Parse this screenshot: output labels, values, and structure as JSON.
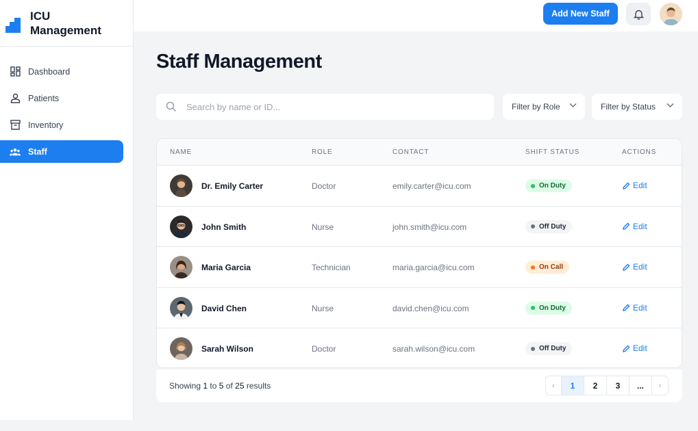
{
  "brand": {
    "line1": "ICU",
    "line2": "Management"
  },
  "sidebar": {
    "items": [
      {
        "label": "Dashboard",
        "icon": "dashboard-grid-icon",
        "active": false
      },
      {
        "label": "Patients",
        "icon": "person-icon",
        "active": false
      },
      {
        "label": "Inventory",
        "icon": "archive-box-icon",
        "active": false
      },
      {
        "label": "Staff",
        "icon": "group-icon",
        "active": true
      }
    ]
  },
  "topbar": {
    "add_label": "Add New Staff"
  },
  "page": {
    "title": "Staff Management"
  },
  "search": {
    "placeholder": "Search by name or ID..."
  },
  "filters": {
    "role": "Filter by Role",
    "status": "Filter by Status"
  },
  "table": {
    "headers": [
      "NAME",
      "ROLE",
      "CONTACT",
      "SHIFT STATUS",
      "ACTIONS"
    ],
    "rows": [
      {
        "name": "Dr. Emily Carter",
        "role": "Doctor",
        "contact": "emily.carter@icu.com",
        "status": "On Duty",
        "action": "Edit"
      },
      {
        "name": "John Smith",
        "role": "Nurse",
        "contact": "john.smith@icu.com",
        "status": "Off Duty",
        "action": "Edit"
      },
      {
        "name": "Maria Garcia",
        "role": "Technician",
        "contact": "maria.garcia@icu.com",
        "status": "On Call",
        "action": "Edit"
      },
      {
        "name": "David Chen",
        "role": "Nurse",
        "contact": "david.chen@icu.com",
        "status": "On Duty",
        "action": "Edit"
      },
      {
        "name": "Sarah Wilson",
        "role": "Doctor",
        "contact": "sarah.wilson@icu.com",
        "status": "Off Duty",
        "action": "Edit"
      }
    ]
  },
  "status_colors": {
    "On Duty": {
      "bg": "#dcfce7",
      "fg": "#166534",
      "dot": "#22c55e"
    },
    "Off Duty": {
      "bg": "#f3f4f6",
      "fg": "#1f2937",
      "dot": "#6b7280"
    },
    "On Call": {
      "bg": "#ffedd5",
      "fg": "#9a3412",
      "dot": "#f97316"
    }
  },
  "pagination": {
    "showing_prefix": "Showing",
    "from": "1",
    "to_word": "to",
    "to": "5",
    "of_word": "of",
    "total": "25",
    "suffix": "results",
    "prev": "‹",
    "pages": [
      "1",
      "2",
      "3",
      "..."
    ],
    "next": "›",
    "current": "1"
  },
  "colors": {
    "accent": "#1d7ef0",
    "background": "#f3f4f6"
  }
}
